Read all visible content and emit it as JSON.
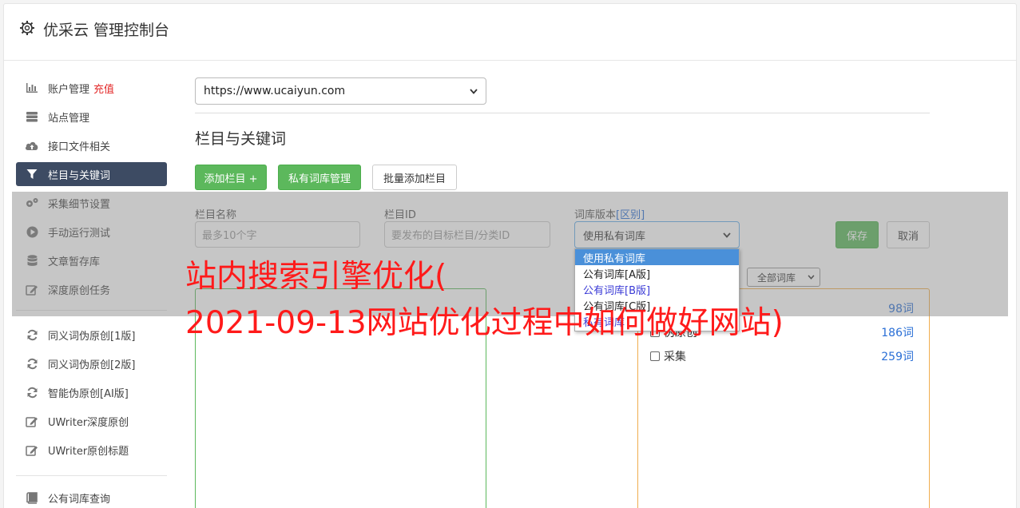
{
  "header": {
    "title": "优采云 管理控制台",
    "icon": "gear-icon"
  },
  "sidebar": {
    "items": [
      {
        "label": "账户管理",
        "badge": "充值",
        "icon": "bar-chart-icon"
      },
      {
        "label": "站点管理",
        "icon": "server-icon"
      },
      {
        "label": "接口文件相关",
        "icon": "cloud-upload-icon"
      },
      {
        "label": "栏目与关键词",
        "icon": "filter-icon",
        "active": true
      },
      {
        "label": "采集细节设置",
        "icon": "cogs-icon"
      },
      {
        "label": "手动运行测试",
        "icon": "play-circle-icon"
      },
      {
        "label": "文章暂存库",
        "icon": "database-icon"
      },
      {
        "label": "深度原创任务",
        "icon": "edit-icon"
      },
      {
        "label": "同义词伪原创[1版]",
        "icon": "refresh-icon"
      },
      {
        "label": "同义词伪原创[2版]",
        "icon": "refresh-icon"
      },
      {
        "label": "智能伪原创[AI版]",
        "icon": "refresh-icon"
      },
      {
        "label": "UWriter深度原创",
        "icon": "edit-icon"
      },
      {
        "label": "UWriter原创标题",
        "icon": "edit-icon"
      },
      {
        "label": "公有词库查询",
        "icon": "book-icon"
      }
    ]
  },
  "main": {
    "site_select": {
      "value": "https://www.ucaiyun.com"
    },
    "section_title": "栏目与关键词",
    "buttons": {
      "add_column": "添加栏目 +",
      "private_lib": "私有词库管理",
      "batch_add": "批量添加栏目"
    },
    "form": {
      "name_label": "栏目名称",
      "name_placeholder": "最多10个字",
      "id_label": "栏目ID",
      "id_placeholder": "要发布的目标栏目/分类ID",
      "version_label": "词库版本",
      "version_link": "[区别]",
      "version_value": "使用私有词库",
      "save": "保存",
      "cancel": "取消"
    },
    "dropdown_options": [
      "使用私有词库",
      "公有词库[A版]",
      "公有词库[B版]",
      "公有词库[C版]",
      "私有词库"
    ],
    "library_filter": "全部词库",
    "library_rows": [
      {
        "label": "伪原创",
        "count": "186词"
      },
      {
        "label": "采集",
        "count": "259词"
      }
    ],
    "partial_count": "98词"
  },
  "watermark": {
    "line1": "站内搜索引擎优化(",
    "line2": "2021-09-13网站优化过程中如何做好网站)"
  }
}
